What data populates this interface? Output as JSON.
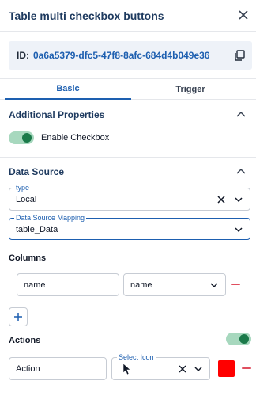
{
  "header": {
    "title": "Table multi checkbox buttons"
  },
  "id_box": {
    "label": "ID:",
    "value": "0a6a5379-dfc5-47f8-8afc-684d4b049e36"
  },
  "tabs": [
    {
      "label": "Basic",
      "active": true
    },
    {
      "label": "Trigger",
      "active": false
    }
  ],
  "additional_properties": {
    "title": "Additional Properties",
    "enable_checkbox": {
      "label": "Enable Checkbox",
      "on": true
    }
  },
  "data_source": {
    "title": "Data Source",
    "type": {
      "legend": "type",
      "value": "Local"
    },
    "mapping": {
      "legend": "Data Source Mapping",
      "value": "table_Data"
    }
  },
  "columns": {
    "title": "Columns",
    "rows": [
      {
        "name": "name",
        "select": "name"
      }
    ]
  },
  "actions": {
    "title": "Actions",
    "enabled": true,
    "rows": [
      {
        "name": "Action",
        "icon_legend": "Select Icon",
        "color": "#ff0000"
      }
    ]
  },
  "colors": {
    "accent": "#1d5fb0",
    "toggle_on": "#1b7a4a",
    "danger": "#e04f5f"
  }
}
